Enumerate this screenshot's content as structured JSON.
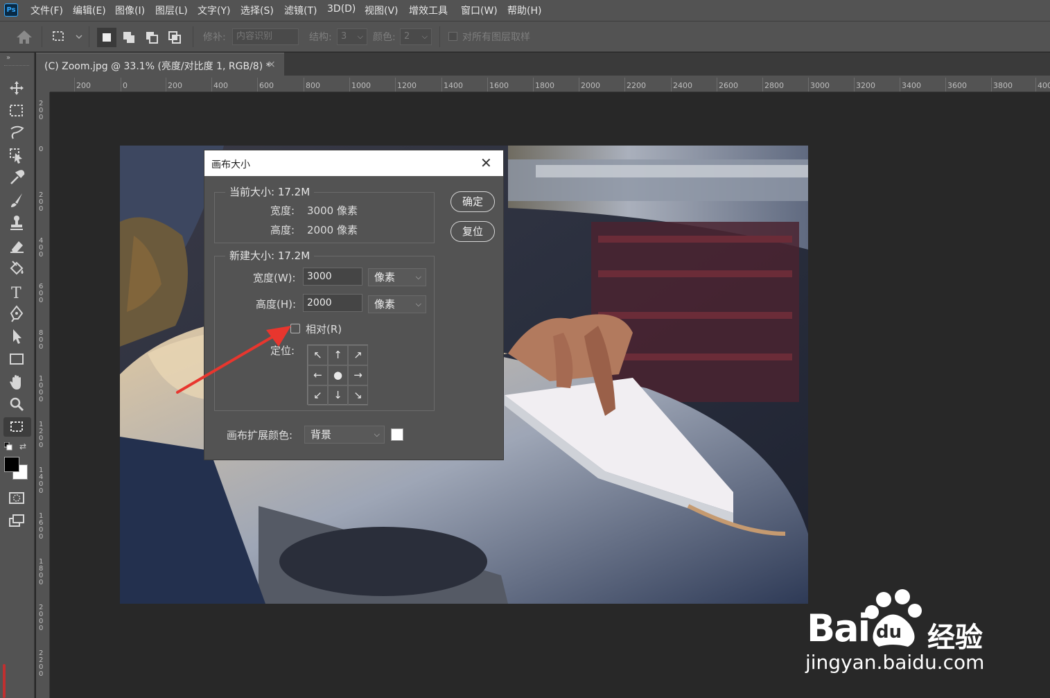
{
  "app": {
    "logo": "Ps"
  },
  "menu": [
    "文件(F)",
    "编辑(E)",
    "图像(I)",
    "图层(L)",
    "文字(Y)",
    "选择(S)",
    "滤镜(T)",
    "3D(D)",
    "视图(V)",
    "增效工具",
    "窗口(W)",
    "帮助(H)"
  ],
  "options": {
    "repair_label": "修补:",
    "repair_value": "内容识别",
    "structure_label": "结构:",
    "structure_value": "3",
    "color_label": "颜色:",
    "color_value": "2",
    "sample_all_label": "对所有图层取样"
  },
  "document_tab": {
    "title": "(C) Zoom.jpg @ 33.1% (亮度/对比度 1, RGB/8) *",
    "close": "×"
  },
  "rulers": {
    "horizontal": [
      "200",
      "0",
      "200",
      "400",
      "600",
      "800",
      "1000",
      "1200",
      "1400",
      "1600",
      "1800",
      "2000",
      "2200",
      "2400",
      "2600",
      "2800",
      "3000",
      "3200",
      "3400",
      "3600",
      "3800",
      "400"
    ],
    "vertical": [
      "200",
      "0",
      "200",
      "400",
      "600",
      "800",
      "1000",
      "1200",
      "1400",
      "1600",
      "1800",
      "2000",
      "2200"
    ]
  },
  "dialog": {
    "title": "画布大小",
    "close": "✕",
    "current": {
      "title": "当前大小: 17.2M",
      "width_label": "宽度:",
      "width_value": "3000 像素",
      "height_label": "高度:",
      "height_value": "2000 像素"
    },
    "new": {
      "title": "新建大小: 17.2M",
      "width_label": "宽度(W):",
      "width_value": "3000",
      "width_unit": "像素",
      "height_label": "高度(H):",
      "height_value": "2000",
      "height_unit": "像素",
      "relative_label": "相对(R)",
      "relative_checked": false,
      "anchor_label": "定位:"
    },
    "extension_color_label": "画布扩展颜色:",
    "extension_color_value": "背景",
    "ok_button": "确定",
    "reset_button": "复位"
  },
  "watermark": {
    "brand": "Bai",
    "brand_du": "du",
    "cn": "经验",
    "url": "jingyan.baidu.com"
  },
  "colors": {
    "accent_arrow": "#e8362e",
    "foreground": "#000000",
    "background": "#ffffff",
    "ps_blue": "#31a8ff"
  }
}
